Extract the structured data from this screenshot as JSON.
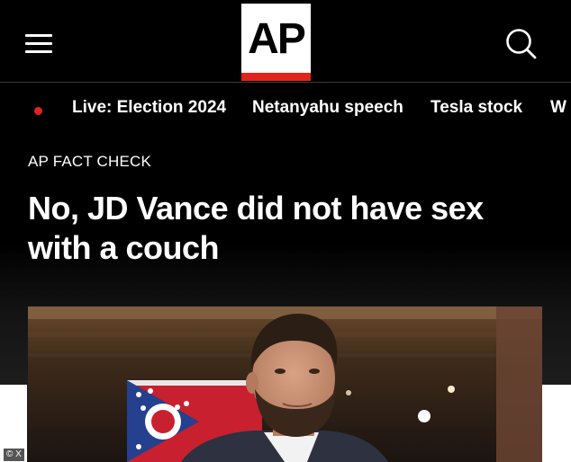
{
  "header": {
    "logo_text": "AP",
    "menu_icon": "hamburger-menu-icon",
    "search_icon": "search-icon",
    "logo_bar_color": "#e2231a"
  },
  "topics": {
    "live_indicator_color": "#e2231a",
    "items": [
      {
        "label": "Live: Election 2024"
      },
      {
        "label": "Netanyahu speech"
      },
      {
        "label": "Tesla stock"
      },
      {
        "label": "W"
      }
    ]
  },
  "article": {
    "kicker": "AP FACT CHECK",
    "headline": "No, JD Vance did not have sex with a couch"
  },
  "photo": {
    "credit": "© X"
  }
}
